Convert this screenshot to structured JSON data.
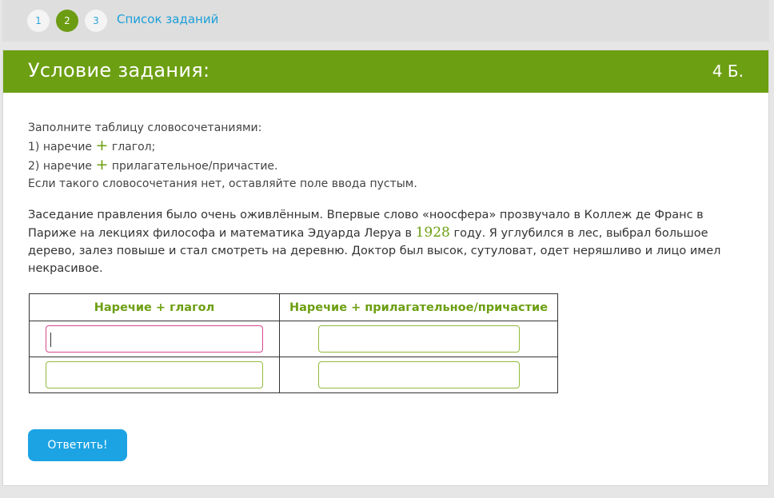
{
  "nav": {
    "steps": [
      "1",
      "2",
      "3"
    ],
    "active_step": "2",
    "task_list_label": "Список заданий"
  },
  "header": {
    "title": "Условие задания:",
    "score": "4 Б."
  },
  "instructions": {
    "line1": "Заполните таблицу словосочетаниями:",
    "line2_a": "1) наречие",
    "line2_b": "глагол;",
    "line3_a": "2) наречие",
    "line3_b": "прилагательное/причастие.",
    "line4": "Если такого словосочетания нет, оставляйте поле ввода пустым.",
    "plus": "+"
  },
  "passage": {
    "part1": "Заседание правления было очень оживлённым. Впервые слово «ноосфера» прозвучало в Коллеж де Франс в Париже на лекциях философа и математика Эдуарда Леруа в",
    "year": "1928",
    "part2": "году. Я углубился в лес, выбрал большое дерево, залез повыше и стал смотреть на деревню. Доктор был высок, сутуловат, одет неряшливо и лицо имел некрасивое."
  },
  "table": {
    "headers": [
      "Наречие + глагол",
      "Наречие + прилагательное/причастие"
    ],
    "rows": [
      [
        "",
        ""
      ],
      [
        "",
        ""
      ]
    ]
  },
  "submit_label": "Ответить!",
  "colors": {
    "accent_green": "#6c9f12",
    "link_blue": "#1a9fd9",
    "button_blue": "#1ca3e3",
    "focus_pink": "#d9488f",
    "field_border": "#93bb3a"
  }
}
